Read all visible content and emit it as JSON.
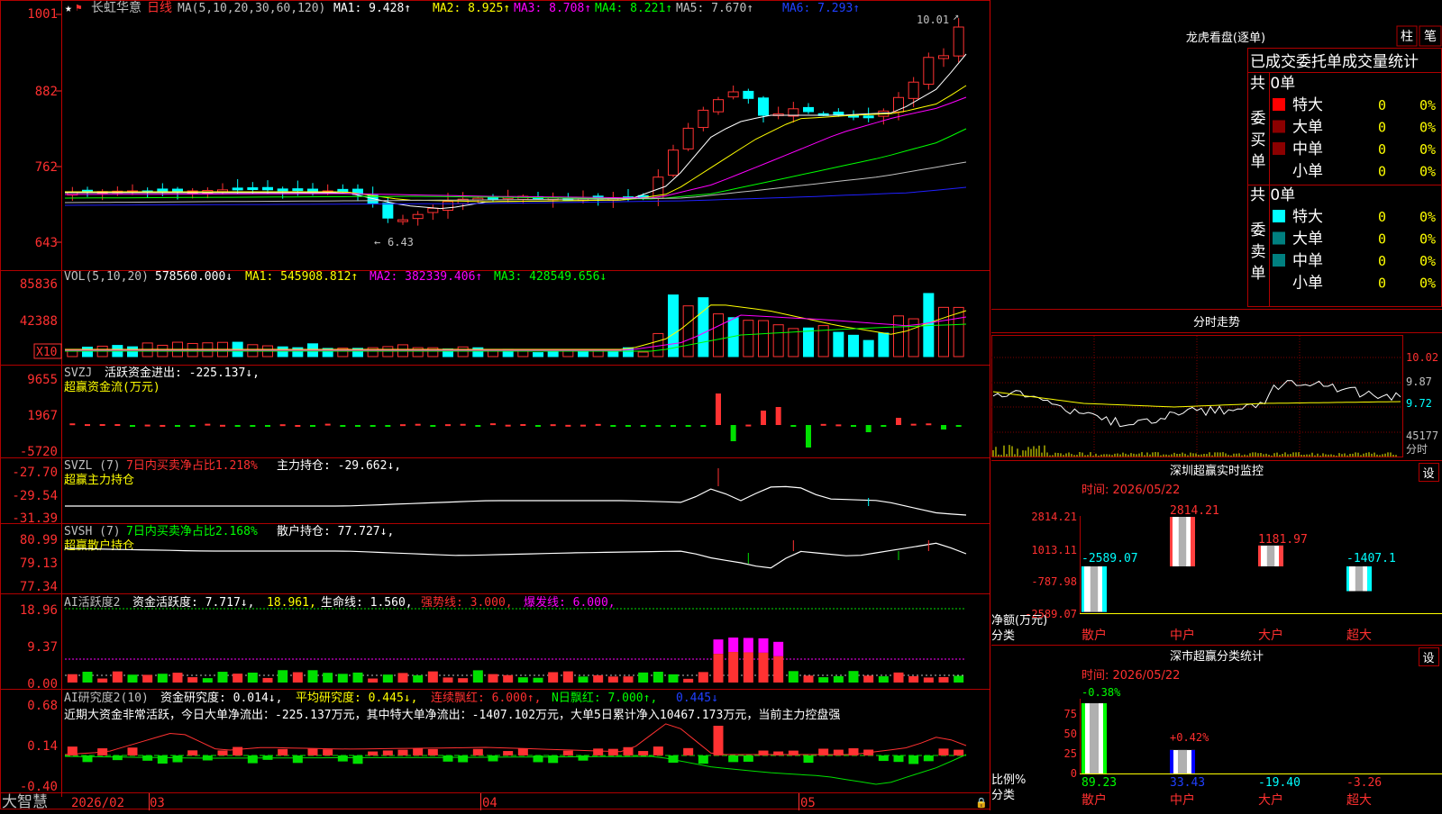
{
  "colors": {
    "up": "#ff3232",
    "down": "#00ffff",
    "bg": "#000000",
    "frame": "#b00000",
    "axis": "#ff3030",
    "ma1": "#ffffff",
    "ma2": "#ffff00",
    "ma3": "#ff00ff",
    "ma4": "#00ff00",
    "ma5": "#c0c0c0",
    "ma6": "#2020ff",
    "green": "#00e000",
    "magenta": "#ff00ff",
    "yellow": "#ffff00"
  },
  "icons": [
    "star-icon",
    "flag-icon",
    "lock-icon"
  ],
  "header": {
    "title": "长虹华意",
    "period": "日线",
    "ma_param": "MA(5,10,20,30,60,120)",
    "ma": [
      {
        "label": "MA1: 9.428↑"
      },
      {
        "label": "MA2: 8.925↑"
      },
      {
        "label": "MA3: 8.708↑"
      },
      {
        "label": "MA4: 8.221↑"
      },
      {
        "label": "MA5: 7.670↑"
      },
      {
        "label": "MA6: 7.293↑"
      }
    ]
  },
  "price_panel": {
    "y_ticks": [
      "1001",
      "882",
      "762",
      "643"
    ],
    "high_label": "10.01",
    "low_label": "6.43"
  },
  "vol_panel": {
    "title": "VOL(5,10,20)",
    "value": "578560.000↓",
    "ma1": "MA1: 545908.812↑",
    "ma2": "MA2: 382339.406↑",
    "ma3": "MA3: 428549.656↓",
    "y_ticks": [
      "85836",
      "42388"
    ],
    "unit": "X10"
  },
  "svzj_panel": {
    "title": "SVZJ",
    "label": "活跃资金进出: -225.137↓,",
    "subtitle": "超赢资金流(万元)",
    "y_ticks": [
      "9655",
      "1967",
      "-5720"
    ]
  },
  "svzl_panel": {
    "title": "SVZL (7)",
    "ratio": "7日内买卖净占比1.218%",
    "label": "主力持仓: -29.662↓,",
    "subtitle": "超赢主力持仓",
    "y_ticks": [
      "-27.70",
      "-29.54",
      "-31.39"
    ]
  },
  "svsh_panel": {
    "title": "SVSH (7)",
    "ratio": "7日内买卖净占比2.168%",
    "label": "散户持仓: 77.727↓,",
    "subtitle": "超赢散户持仓",
    "y_ticks": [
      "80.99",
      "79.13",
      "77.34"
    ]
  },
  "ai1_panel": {
    "title": "AI活跃度2",
    "label": "资金活跃度: 7.717↓,",
    "v2": "18.961,",
    "life": "生命线: 1.560,",
    "strong": "强势线: 3.000,",
    "burst": "爆发线: 6.000,",
    "y_ticks": [
      "18.96",
      "9.37",
      "0.00"
    ]
  },
  "ai2_panel": {
    "title": "AI研究度2(10)",
    "label": "资金研究度: 0.014↓,",
    "avg": "平均研究度: 0.445↓,",
    "red": "连续飘红: 6.000↑,",
    "nred": "N日飘红: 7.000↑,",
    "last": "0.445↓",
    "summary": "近期大资金非常活跃，今日大单净流出：-225.137万元，其中特大单净流出：-1407.102万元，大单5日累计净入10467.173万元，当前主力控盘强",
    "y_ticks": [
      "0.68",
      "0.14",
      "-0.40"
    ]
  },
  "x_axis": {
    "labels": [
      "2026/02",
      "03",
      "04",
      "05"
    ]
  },
  "logo": "大智慧",
  "dragon": {
    "title": "龙虎看盘(逐单)",
    "btn_bar": "柱",
    "btn_stroke": "笔",
    "header": "已成交委托单成交量统计",
    "buy": {
      "side": "委买单",
      "total": "共 0单",
      "rows": [
        {
          "name": "特大",
          "val": "0",
          "pct": "0%"
        },
        {
          "name": "大单",
          "val": "0",
          "pct": "0%"
        },
        {
          "name": "中单",
          "val": "0",
          "pct": "0%"
        },
        {
          "name": "小单",
          "val": "0",
          "pct": "0%"
        }
      ]
    },
    "sell": {
      "side": "委卖单",
      "total": "共 0单",
      "rows": [
        {
          "name": "特大",
          "val": "0",
          "pct": "0%"
        },
        {
          "name": "大单",
          "val": "0",
          "pct": "0%"
        },
        {
          "name": "中单",
          "val": "0",
          "pct": "0%"
        },
        {
          "name": "小单",
          "val": "0",
          "pct": "0%"
        }
      ]
    }
  },
  "intraday": {
    "title": "分时走势",
    "y_ticks": [
      "10.02",
      "9.87",
      "9.72",
      "45177"
    ],
    "unit": "分时"
  },
  "sz_monitor": {
    "title": "深圳超赢实时监控",
    "settings": "设",
    "date": "时间: 2026/05/22",
    "y_ticks": [
      "2814.21",
      "1013.11",
      "-787.98",
      "-2589.07"
    ],
    "ylabel": "净额(万元)",
    "xlabel": "分类",
    "bars": [
      {
        "cat": "散户",
        "label": "-2589.07"
      },
      {
        "cat": "中户",
        "label": "2814.21"
      },
      {
        "cat": "大户",
        "label": "1181.97"
      },
      {
        "cat": "超大",
        "label": "-1407.1"
      }
    ]
  },
  "sz_stats": {
    "title": "深市超赢分类统计",
    "settings": "设",
    "date": "时间: 2026/05/22",
    "y_ticks": [
      "75",
      "50",
      "25",
      "0"
    ],
    "ylabel": "比例%",
    "xlabel": "分类",
    "bars": [
      {
        "cat": "散户",
        "top": "-0.38%",
        "bottom": "89.23"
      },
      {
        "cat": "中户",
        "top": "+0.42%",
        "bottom": "33.43"
      },
      {
        "cat": "大户",
        "top": "",
        "bottom": "-19.40"
      },
      {
        "cat": "超大",
        "top": "",
        "bottom": "-3.26"
      }
    ]
  }
}
